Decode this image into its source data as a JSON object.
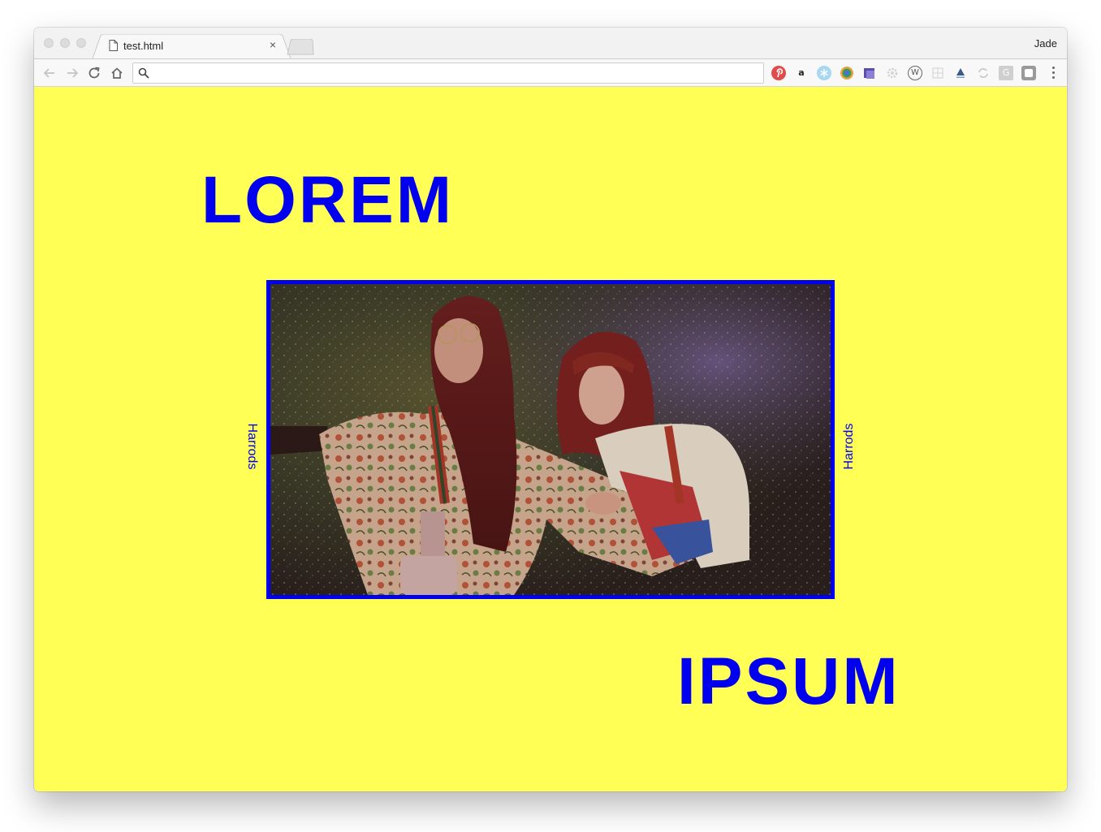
{
  "browser": {
    "tab": {
      "title": "test.html",
      "close_glyph": "×"
    },
    "profile_name": "Jade",
    "omnibox": {
      "value": "",
      "placeholder": ""
    },
    "extensions": [
      "pinterest-icon",
      "amazon-icon",
      "snowflake-icon",
      "chrome-color-icon",
      "bookmark-stack-icon",
      "gear-icon",
      "wordpress-icon",
      "grid-icon",
      "triangle-icon",
      "sync-icon",
      "google-docs-icon",
      "square-icon"
    ],
    "extension_glyphs": {
      "amazon": "a",
      "wordpress": "W",
      "google": "G"
    }
  },
  "page": {
    "background": "#ffff55",
    "accent": "#0000ee",
    "headline_top": "LOREM",
    "headline_bottom": "IPSUM",
    "side_label_left": "Harrods",
    "side_label_right": "Harrods",
    "photo_alt": "Two women with red hair wearing floral jacket and varsity sweater against sparkly wall"
  }
}
